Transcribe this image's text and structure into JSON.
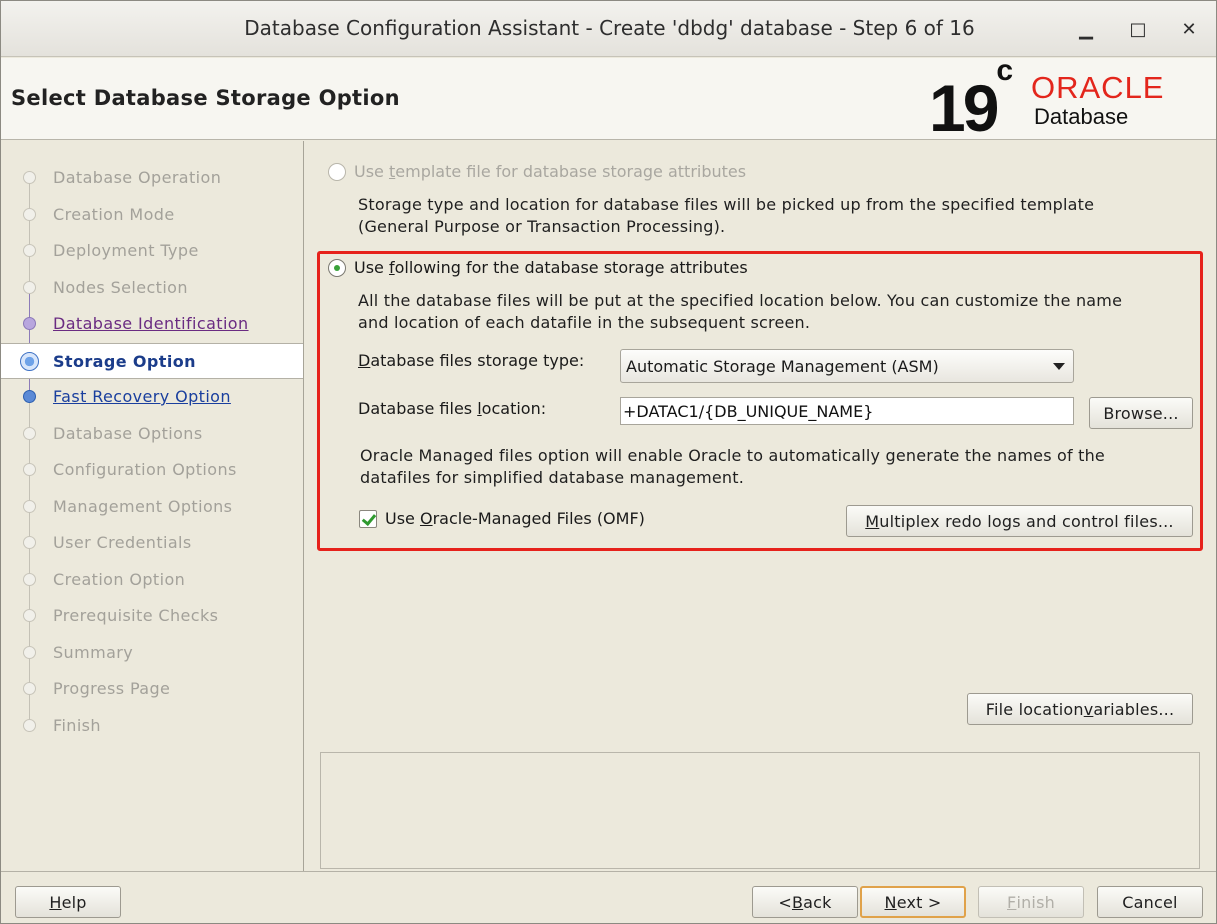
{
  "window": {
    "title": "Database Configuration Assistant - Create 'dbdg' database - Step 6 of 16",
    "minimize": "▁",
    "maximize": "□",
    "close": "✕"
  },
  "header": {
    "page_title": "Select Database Storage Option",
    "logo": {
      "version": "19",
      "sup": "c",
      "brand": "ORACLE",
      "product": "Database",
      "brand_color": "#e3261c"
    }
  },
  "steps": [
    {
      "label": "Database Operation",
      "state": "pending"
    },
    {
      "label": "Creation Mode",
      "state": "pending"
    },
    {
      "label": "Deployment Type",
      "state": "pending"
    },
    {
      "label": "Nodes Selection",
      "state": "pending"
    },
    {
      "label": "Database Identification",
      "state": "visited"
    },
    {
      "label": "Storage Option",
      "state": "current"
    },
    {
      "label": "Fast Recovery Option",
      "state": "next"
    },
    {
      "label": "Database Options",
      "state": "pending"
    },
    {
      "label": "Configuration Options",
      "state": "pending"
    },
    {
      "label": "Management Options",
      "state": "pending"
    },
    {
      "label": "User Credentials",
      "state": "pending"
    },
    {
      "label": "Creation Option",
      "state": "pending"
    },
    {
      "label": "Prerequisite Checks",
      "state": "pending"
    },
    {
      "label": "Summary",
      "state": "pending"
    },
    {
      "label": "Progress Page",
      "state": "pending"
    },
    {
      "label": "Finish",
      "state": "pending"
    }
  ],
  "main": {
    "template_option": {
      "label_pre": "Use ",
      "label_mn": "t",
      "label_post": "emplate file for database storage attributes",
      "selected": false,
      "enabled": false,
      "desc_line1": "Storage type and location for database files will be picked up from the specified template",
      "desc_line2": "(General Purpose or Transaction Processing)."
    },
    "following_option": {
      "label_pre": "Use ",
      "label_mn": "f",
      "label_post": "ollowing for the database storage attributes",
      "selected": true,
      "desc_line1": "All the database files will be put at the specified location below. You can customize the name",
      "desc_line2": "and location of each datafile in the subsequent screen."
    },
    "storage_type": {
      "label_mn": "D",
      "label_rest": "atabase files storage type:",
      "value": "Automatic Storage Management (ASM)"
    },
    "files_location": {
      "label_pre": "Database files ",
      "label_mn": "l",
      "label_post": "ocation:",
      "value": "+DATAC1/{DB_UNIQUE_NAME}",
      "browse_label": "Browse..."
    },
    "omf": {
      "info_line1": "Oracle Managed files option will enable Oracle to automatically generate the names of the",
      "info_line2": "datafiles for simplified database management.",
      "checkbox_pre": "Use ",
      "checkbox_mn": "O",
      "checkbox_post": "racle-Managed Files (OMF)",
      "checked": true,
      "multiplex_mn": "M",
      "multiplex_rest": "ultiplex redo logs and control files..."
    },
    "file_location_variables": {
      "pre": "File location ",
      "mn": "v",
      "post": "ariables..."
    },
    "highlight_color": "#e6221b"
  },
  "footer": {
    "help_mn": "H",
    "help_rest": "elp",
    "back_pre": "< ",
    "back_mn": "B",
    "back_rest": "ack",
    "next_mn": "N",
    "next_rest": "ext >",
    "finish_mn": "F",
    "finish_rest": "inish",
    "cancel": "Cancel"
  }
}
